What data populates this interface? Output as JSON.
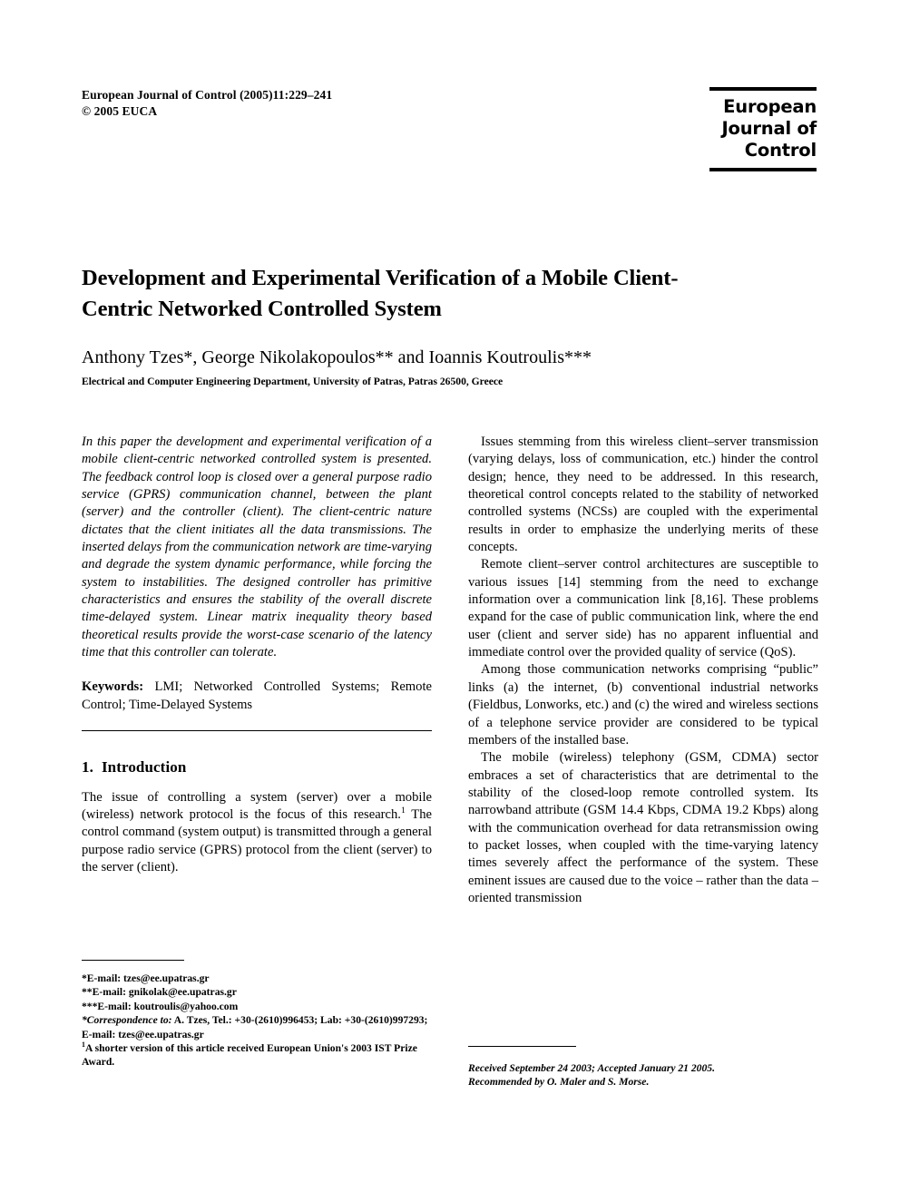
{
  "header": {
    "citation_line1": "European Journal of Control (2005)11:229–241",
    "citation_line2": "© 2005 EUCA",
    "logo_line1": "European",
    "logo_line2": "Journal of",
    "logo_line3": "Control"
  },
  "article": {
    "title": "Development and Experimental Verification of a Mobile Client-Centric Networked Controlled System",
    "authors": "Anthony Tzes*, George Nikolakopoulos** and Ioannis Koutroulis***",
    "affiliation": "Electrical and Computer Engineering Department, University of Patras, Patras 26500, Greece",
    "abstract": "In this paper the development and experimental verification of a mobile client-centric networked controlled system is presented. The feedback control loop is closed over a general purpose radio service (GPRS) communication channel, between the plant (server) and the controller (client). The client-centric nature dictates that the client initiates all the data transmissions. The inserted delays from the communication network are time-varying and degrade the system dynamic performance, while forcing the system to instabilities. The designed controller has primitive characteristics and ensures the stability of the overall discrete time-delayed system. Linear matrix inequality theory based theoretical results provide the worst-case scenario of the latency time that this controller can tolerate.",
    "keywords_label": "Keywords:",
    "keywords_value": "LMI; Networked Controlled Systems; Remote Control; Time-Delayed Systems"
  },
  "sections": {
    "intro_number": "1.",
    "intro_title": "Introduction",
    "intro_p1_a": "The issue of controlling a system (server) over a mobile (wireless) network protocol is the focus of this research.",
    "intro_p1_marker": "1",
    "intro_p1_b": " The control command (system output) is transmitted through a general purpose radio service (GPRS) protocol from the client (server) to the server (client)."
  },
  "right_column": {
    "p1": "Issues stemming from this wireless client–server transmission (varying delays, loss of communication, etc.) hinder the control design; hence, they need to be addressed. In this research, theoretical control concepts related to the stability of networked controlled systems (NCSs) are coupled with the experimental results in order to emphasize the underlying merits of these concepts.",
    "p2": "Remote client–server control architectures are susceptible to various issues [14] stemming from the need to exchange information over a communication link [8,16]. These problems expand for the case of public communication link, where the end user (client and server side) has no apparent influential and immediate control over the provided quality of service (QoS).",
    "p3": "Among those communication networks comprising “public” links (a) the internet, (b) conventional industrial networks (Fieldbus, Lonworks, etc.) and (c) the wired and wireless sections of a telephone service provider are considered to be typical members of the installed base.",
    "p4": "The mobile (wireless) telephony (GSM, CDMA) sector embraces a set of characteristics that are detrimental to the stability of the closed-loop remote controlled system. Its narrowband attribute (GSM 14.4 Kbps, CDMA 19.2 Kbps) along with the communication overhead for data retransmission owing to packet losses, when coupled with the time-varying latency times severely affect the performance of the system. These eminent issues are caused due to the voice – rather than the data – oriented transmission"
  },
  "footnotes": {
    "f1": "*E-mail: tzes@ee.upatras.gr",
    "f2": "**E-mail: gnikolak@ee.upatras.gr",
    "f3": "***E-mail: koutroulis@yahoo.com",
    "f4_italic": "*Correspondence to:",
    "f4_rest": " A. Tzes, Tel.: +30-(2610)996453; Lab: +30-(2610)997293; E-mail: tzes@ee.upatras.gr",
    "f5_marker": "1",
    "f5_text": "A shorter version of this article received European Union's 2003 IST Prize Award."
  },
  "received": {
    "line1": "Received September 24 2003; Accepted January 21 2005.",
    "line2": "Recommended by O. Maler and S. Morse."
  }
}
